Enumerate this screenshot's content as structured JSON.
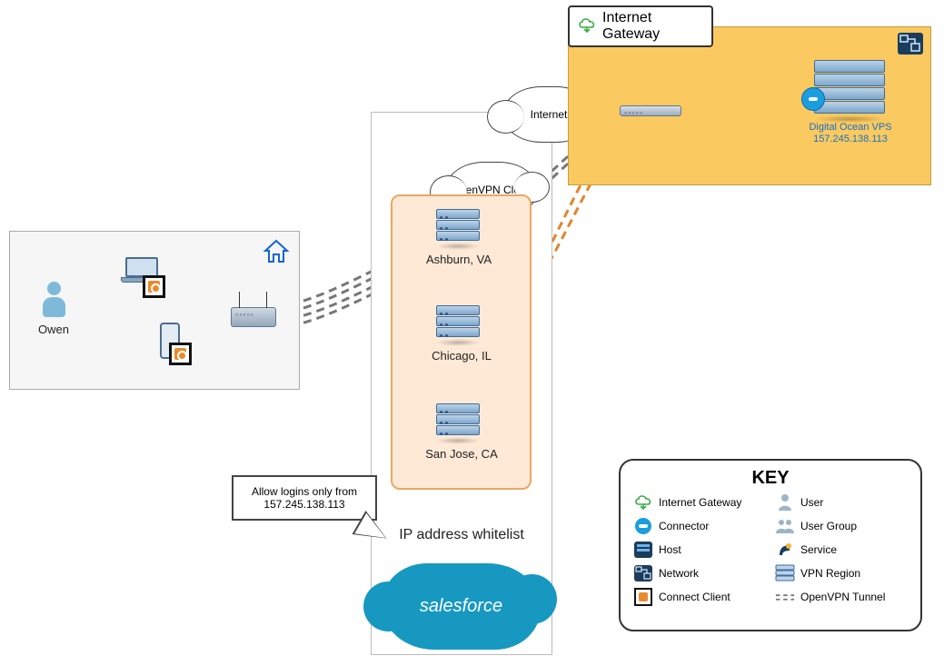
{
  "owen": {
    "name": "Owen"
  },
  "home": {
    "icon_name": "home-icon"
  },
  "cloud_internet": {
    "label": "Internet"
  },
  "cloud_ovpn": {
    "label": "OpenVPN Cloud"
  },
  "regions": {
    "r1": "Ashburn, VA",
    "r2": "Chicago, IL",
    "r3": "San Jose, CA"
  },
  "center": {
    "whitelist_label": "IP address whitelist",
    "callout": "Allow logins only from 157.245.138.113",
    "salesforce": "salesforce"
  },
  "gateway": {
    "label": "Internet Gateway"
  },
  "vps": {
    "name": "Digital Ocean VPS",
    "ip": "157.245.138.113"
  },
  "key": {
    "title": "KEY",
    "items": {
      "ig": "Internet Gateway",
      "connector": "Connector",
      "host": "Host",
      "network": "Network",
      "cc": "Connect Client",
      "user": "User",
      "ug": "User Group",
      "service": "Service",
      "region": "VPN Region",
      "tunnel": "OpenVPN Tunnel"
    }
  }
}
